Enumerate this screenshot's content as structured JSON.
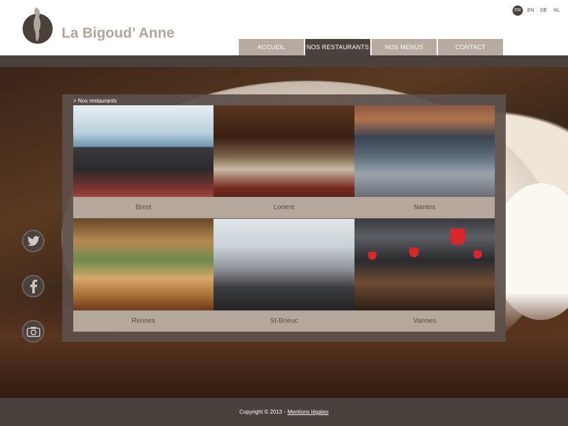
{
  "header": {
    "brand": "La Bigoud’ Anne",
    "languages": [
      {
        "code": "FR",
        "active": true
      },
      {
        "code": "EN",
        "active": false
      },
      {
        "code": "DE",
        "active": false
      },
      {
        "code": "NL",
        "active": false
      }
    ],
    "nav": [
      {
        "label": "ACCUEIL",
        "active": false
      },
      {
        "label": "NOS RESTAURANTS",
        "active": true
      },
      {
        "label": "NOS MENUS",
        "active": false
      },
      {
        "label": "CONTACT",
        "active": false
      }
    ]
  },
  "social": [
    {
      "icon": "twitter-icon"
    },
    {
      "icon": "facebook-icon"
    },
    {
      "icon": "photo-icon"
    }
  ],
  "main": {
    "breadcrumb": "> Nos restaurants",
    "restaurants": [
      {
        "name": "Brest",
        "photo": "restaurant-photo-brest"
      },
      {
        "name": "Lorient",
        "photo": "restaurant-photo-lorient"
      },
      {
        "name": "Nantes",
        "photo": "restaurant-photo-nantes"
      },
      {
        "name": "Rennes",
        "photo": "restaurant-photo-rennes"
      },
      {
        "name": "St-Brieuc",
        "photo": "restaurant-photo-stbrieuc"
      },
      {
        "name": "Vannes",
        "photo": "restaurant-photo-vannes"
      }
    ]
  },
  "footer": {
    "copyright": "Copyright © 2013 -",
    "legal_link": "Mentions légales"
  },
  "colors": {
    "brand": "#b2a59d",
    "dark": "#4a403c",
    "nav": "#b7aaa0",
    "caption": "#b6a79c"
  }
}
